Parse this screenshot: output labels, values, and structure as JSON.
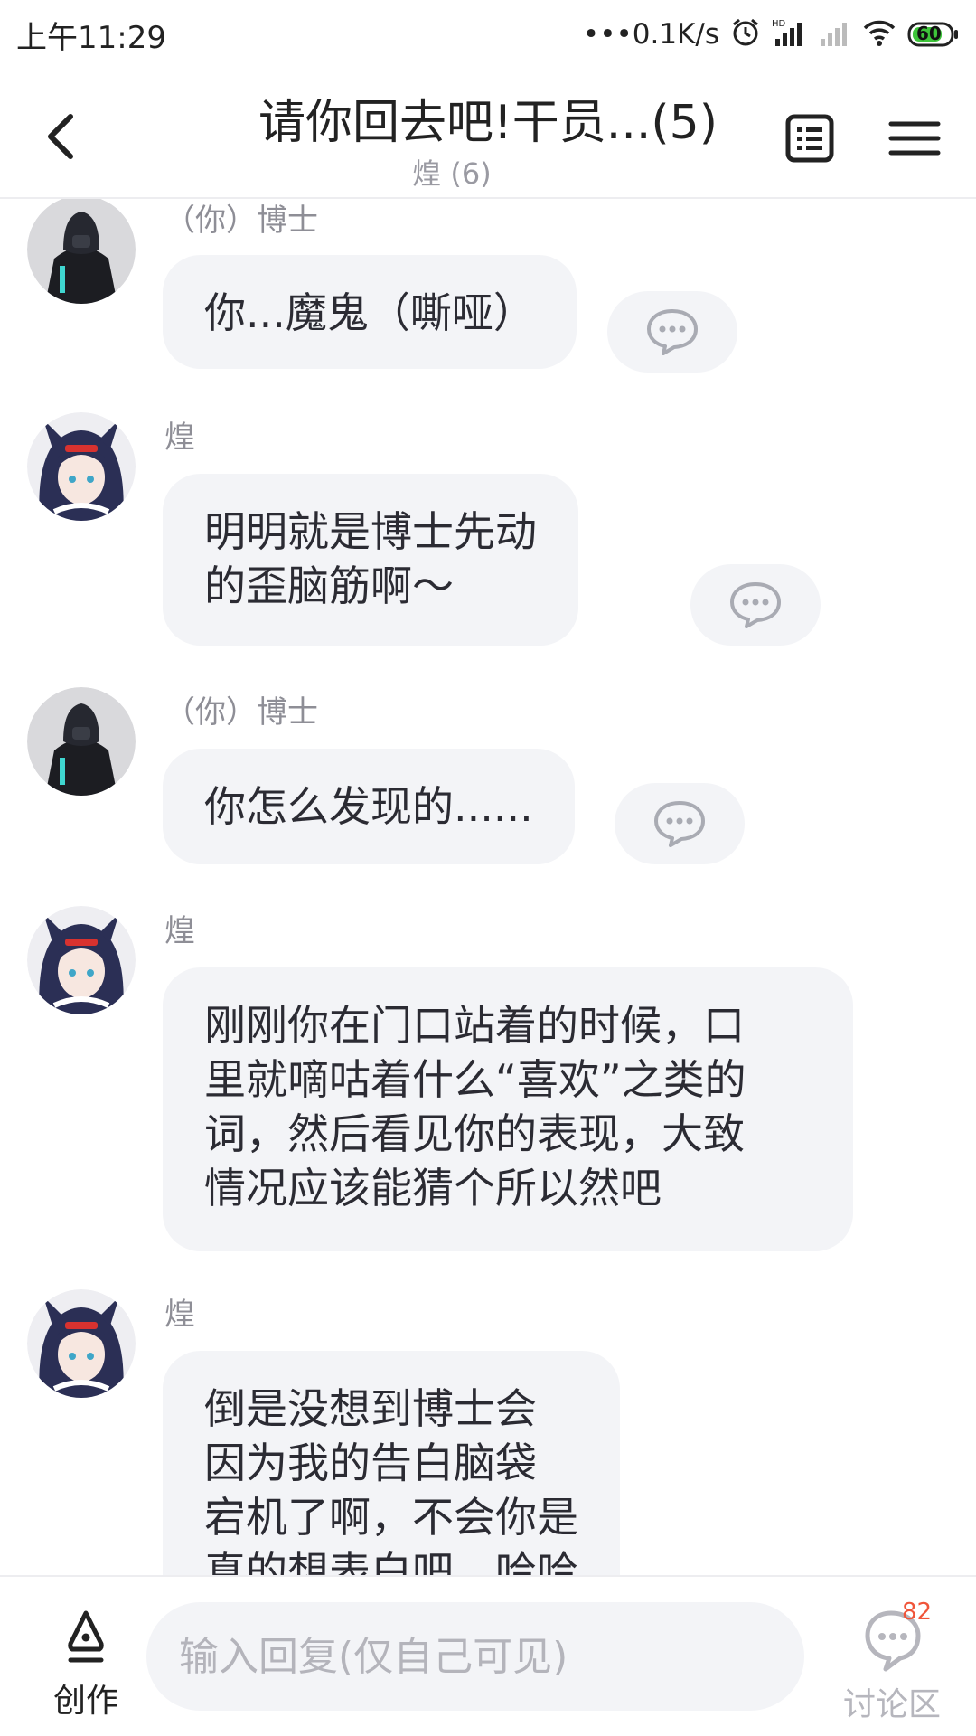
{
  "status_bar": {
    "time": "上午11:29",
    "net_speed": "•••0.1K/s",
    "battery": "60",
    "icons": [
      "alarm-icon",
      "hd-signal-icon",
      "signal-icon",
      "wifi-icon",
      "battery-icon"
    ]
  },
  "header": {
    "title": "请你回去吧!干员...(5)",
    "subtitle": "煌 (6)",
    "icons": [
      "back-icon",
      "list-icon",
      "menu-icon"
    ]
  },
  "messages": [
    {
      "sender": "（你）博士",
      "text": "你...魔鬼（嘶哑）",
      "avatar": "doctor-avatar"
    },
    {
      "sender": "煌",
      "text": "明明就是博士先动\n的歪脑筋啊～",
      "avatar": "blaze-avatar"
    },
    {
      "sender": "（你）博士",
      "text": "你怎么发现的......",
      "avatar": "doctor-avatar"
    },
    {
      "sender": "煌",
      "text": "刚刚你在门口站着的时候，口\n里就嘀咕着什么“喜欢”之类的\n词，然后看见你的表现，大致\n情况应该能猜个所以然吧",
      "avatar": "blaze-avatar"
    },
    {
      "sender": "煌",
      "text": "倒是没想到博士会\n因为我的告白脑袋\n宕机了啊，不会你是\n真的想表白吧，哈哈",
      "avatar": "blaze-avatar"
    }
  ],
  "bottom_bar": {
    "create_label": "创作",
    "reply_placeholder": "输入回复(仅自己可见)",
    "discuss_label": "讨论区",
    "discuss_count": "82"
  },
  "colors": {
    "bubble": "#f3f4f7",
    "muted_text": "#8e8e96",
    "badge": "#f0553a"
  }
}
